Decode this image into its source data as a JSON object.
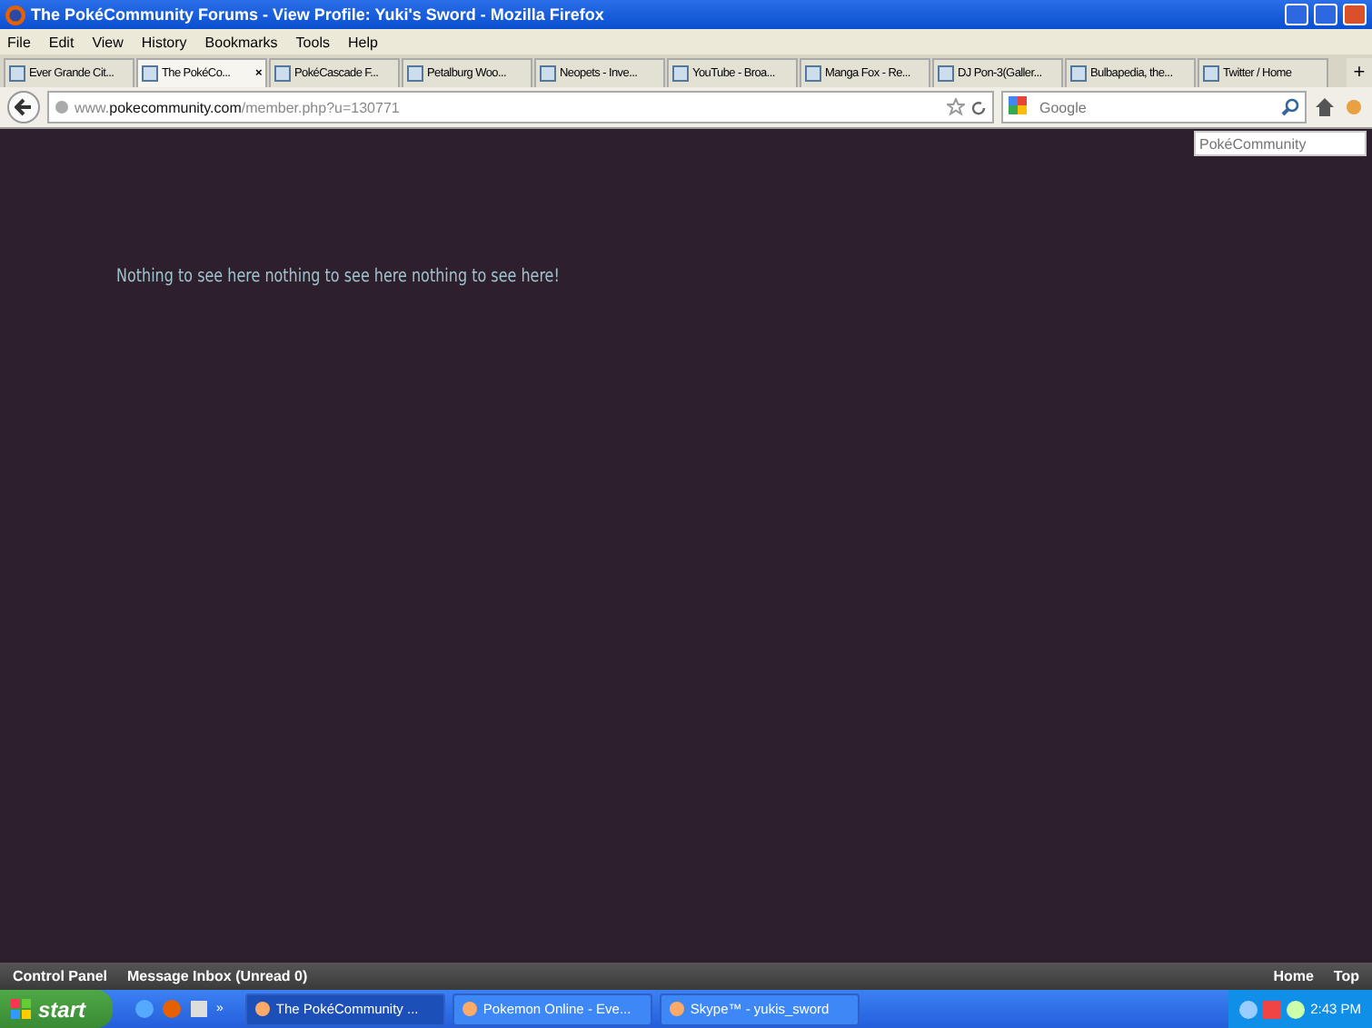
{
  "window": {
    "title": "The PokéCommunity Forums - View Profile: Yuki's Sword - Mozilla Firefox"
  },
  "menu": [
    "File",
    "Edit",
    "View",
    "History",
    "Bookmarks",
    "Tools",
    "Help"
  ],
  "tabs": [
    {
      "label": "Ever Grande Cit...",
      "selected": false
    },
    {
      "label": "The PokéCo...",
      "selected": true
    },
    {
      "label": "PokéCascade F...",
      "selected": false
    },
    {
      "label": "Petalburg Woo...",
      "selected": false
    },
    {
      "label": "Neopets - Inve...",
      "selected": false
    },
    {
      "label": "YouTube - Broa...",
      "selected": false
    },
    {
      "label": "Manga Fox - Re...",
      "selected": false
    },
    {
      "label": "DJ Pon-3(Galler...",
      "selected": false
    },
    {
      "label": "Bulbapedia, the...",
      "selected": false
    },
    {
      "label": "Twitter / Home",
      "selected": false
    }
  ],
  "tab_close": "×",
  "new_tab": "+",
  "address": {
    "domain_prefix": "www.",
    "domain": "pokecommunity.com",
    "path": "/member.php?u=130771"
  },
  "search": {
    "placeholder": "Google"
  },
  "page": {
    "search_box": {
      "placeholder": "PokéCommunity"
    },
    "message": "Nothing to see here nothing to see here nothing to see here!"
  },
  "footer": {
    "left": [
      "Control Panel",
      "Message Inbox (Unread 0)"
    ],
    "right": [
      "Home",
      "Top"
    ]
  },
  "taskbar": {
    "start": "start",
    "buttons": [
      {
        "label": "The PokéCommunity ...",
        "selected": true
      },
      {
        "label": "Pokemon Online - Eve...",
        "selected": false
      },
      {
        "label": "Skype™ - yukis_sword",
        "selected": false
      }
    ],
    "more": "»",
    "clock": "2:43 PM"
  }
}
